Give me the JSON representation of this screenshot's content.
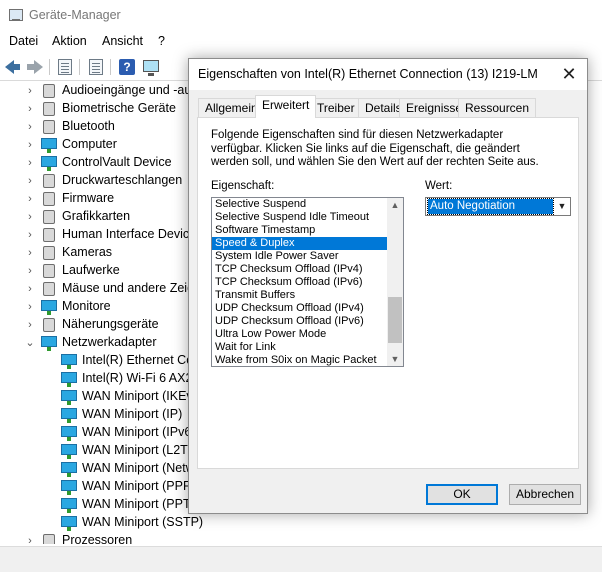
{
  "main_window": {
    "title": "Geräte-Manager",
    "menu": [
      "Datei",
      "Aktion",
      "Ansicht",
      "?"
    ]
  },
  "toolbar_icons": [
    "back-icon",
    "forward-icon",
    "properties-icon",
    "document-icon",
    "help-icon",
    "monitor-icon"
  ],
  "tree": {
    "categories": [
      {
        "label": "Audioeingänge und -aus",
        "icon": "audio-icon",
        "expanded": false
      },
      {
        "label": "Biometrische Geräte",
        "icon": "biometric-icon",
        "expanded": false
      },
      {
        "label": "Bluetooth",
        "icon": "bluetooth-icon",
        "expanded": false
      },
      {
        "label": "Computer",
        "icon": "computer-icon",
        "expanded": false
      },
      {
        "label": "ControlVault Device",
        "icon": "device-icon",
        "expanded": false
      },
      {
        "label": "Druckwarteschlangen",
        "icon": "printer-icon",
        "expanded": false
      },
      {
        "label": "Firmware",
        "icon": "firmware-icon",
        "expanded": false
      },
      {
        "label": "Grafikkarten",
        "icon": "display-adapter-icon",
        "expanded": false
      },
      {
        "label": "Human Interface Device",
        "icon": "hid-icon",
        "expanded": false
      },
      {
        "label": "Kameras",
        "icon": "camera-icon",
        "expanded": false
      },
      {
        "label": "Laufwerke",
        "icon": "drive-icon",
        "expanded": false
      },
      {
        "label": "Mäuse und andere Zeig",
        "icon": "mouse-icon",
        "expanded": false
      },
      {
        "label": "Monitore",
        "icon": "monitor-icon",
        "expanded": false
      },
      {
        "label": "Näherungsgeräte",
        "icon": "proximity-icon",
        "expanded": false
      },
      {
        "label": "Netzwerkadapter",
        "icon": "network-adapter-icon",
        "expanded": true
      }
    ],
    "network_children": [
      "Intel(R) Ethernet Cor",
      "Intel(R) Wi-Fi 6 AX20",
      "WAN Miniport (IKEv",
      "WAN Miniport (IP)",
      "WAN Miniport (IPv6",
      "WAN Miniport (L2TP",
      "WAN Miniport (Netw",
      "WAN Miniport (PPPO",
      "WAN Miniport (PPTP",
      "WAN Miniport (SSTP)"
    ],
    "after": {
      "label": "Prozessoren",
      "icon": "processor-icon"
    }
  },
  "dialog": {
    "title": "Eigenschaften von Intel(R) Ethernet Connection (13) I219-LM",
    "close_symbol": "✕",
    "tabs": [
      "Allgemein",
      "Erweitert",
      "Treiber",
      "Details",
      "Ereignisse",
      "Ressourcen"
    ],
    "active_tab": "Erweitert",
    "description": "Folgende Eigenschaften sind für diesen Netzwerkadapter verfügbar. Klicken Sie links auf die Eigenschaft, die geändert werden soll, und wählen Sie den Wert auf der rechten Seite aus.",
    "property_label": "Eigenschaft:",
    "value_label": "Wert:",
    "properties": [
      "Selective Suspend",
      "Selective Suspend Idle Timeout",
      "Software Timestamp",
      "Speed & Duplex",
      "System Idle Power Saver",
      "TCP Checksum Offload (IPv4)",
      "TCP Checksum Offload (IPv6)",
      "Transmit Buffers",
      "UDP Checksum Offload (IPv4)",
      "UDP Checksum Offload (IPv6)",
      "Ultra Low Power Mode",
      "Wait for Link",
      "Wake from S0ix on Magic Packet"
    ],
    "selected_property": "Speed & Duplex",
    "list_scroll_position": 0.9,
    "value": "Auto Negotiation",
    "ok_label": "OK",
    "cancel_label": "Abbrechen"
  },
  "colors": {
    "selection": "#0078d7",
    "dialog_bg": "#f0f0f0",
    "network_icon": "#2aa7e1"
  }
}
